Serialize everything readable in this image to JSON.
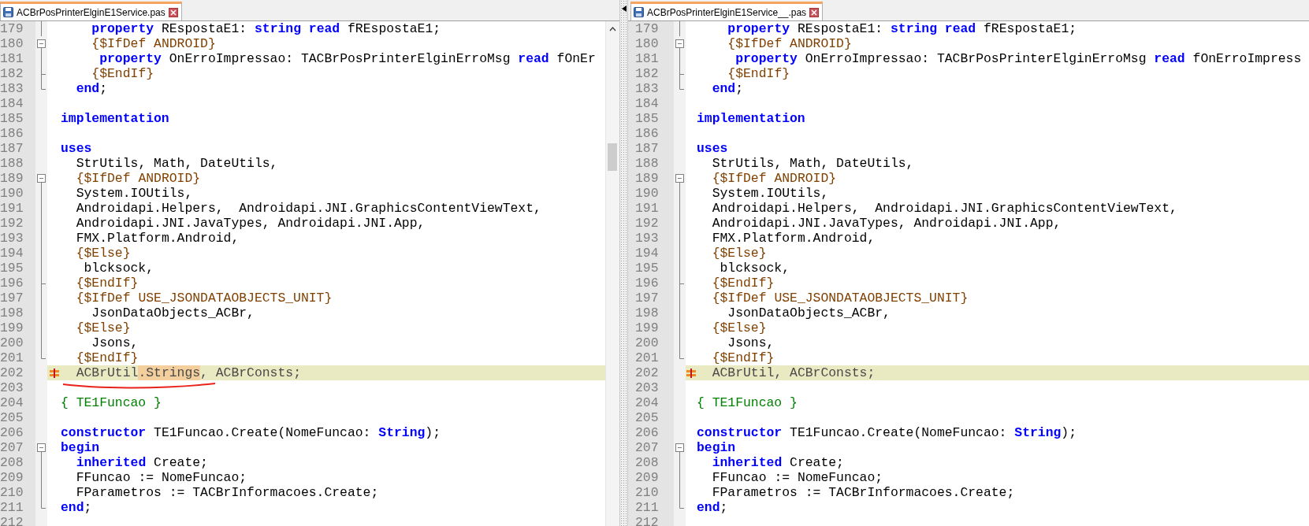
{
  "panes": [
    {
      "tab": {
        "title": "ACBrPosPrinterElginE1Service.pas",
        "selected": true
      },
      "lines": [
        {
          "number": "179",
          "kind": "fold-mid",
          "changed": false,
          "segments": [
            {
              "kind": "keyword",
              "text": "    property"
            },
            {
              "kind": "plain",
              "text": " REspostaE1: "
            },
            {
              "kind": "keyword",
              "text": "string"
            },
            {
              "kind": "keyword",
              "text": " read"
            },
            {
              "kind": "plain",
              "text": " fREspostaE1;"
            }
          ]
        },
        {
          "number": "180",
          "kind": "fold-start",
          "changed": false,
          "segments": [
            {
              "kind": "directive",
              "text": "    {$IfDef ANDROID}"
            }
          ]
        },
        {
          "number": "181",
          "kind": "fold-mid",
          "changed": false,
          "segments": [
            {
              "kind": "keyword",
              "text": "     property"
            },
            {
              "kind": "plain",
              "text": " OnErroImpressao: TACBrPosPrinterElginErroMsg "
            },
            {
              "kind": "keyword",
              "text": "read"
            },
            {
              "kind": "plain",
              "text": " fOnEr"
            }
          ]
        },
        {
          "number": "182",
          "kind": "fold-branch",
          "changed": false,
          "segments": [
            {
              "kind": "directive",
              "text": "    {$EndIf}"
            }
          ]
        },
        {
          "number": "183",
          "kind": "fold-end",
          "changed": false,
          "segments": [
            {
              "kind": "keyword",
              "text": "  end"
            },
            {
              "kind": "plain",
              "text": ";"
            }
          ]
        },
        {
          "number": "184",
          "kind": "plain",
          "changed": false
        },
        {
          "number": "185",
          "kind": "plain",
          "changed": false,
          "segments": [
            {
              "kind": "keyword",
              "text": "implementation"
            }
          ]
        },
        {
          "number": "186",
          "kind": "plain",
          "changed": false
        },
        {
          "number": "187",
          "kind": "plain",
          "changed": false,
          "segments": [
            {
              "kind": "keyword",
              "text": "uses"
            }
          ]
        },
        {
          "number": "188",
          "kind": "plain",
          "changed": false,
          "segments": [
            {
              "kind": "plain",
              "text": "  StrUtils, Math, DateUtils,"
            }
          ]
        },
        {
          "number": "189",
          "kind": "fold-start",
          "changed": false,
          "segments": [
            {
              "kind": "directive",
              "text": "  {$IfDef ANDROID}"
            }
          ]
        },
        {
          "number": "190",
          "kind": "fold-mid",
          "changed": false,
          "segments": [
            {
              "kind": "plain",
              "text": "  System.IOUtils,"
            }
          ]
        },
        {
          "number": "191",
          "kind": "fold-mid",
          "changed": false,
          "segments": [
            {
              "kind": "plain",
              "text": "  Androidapi.Helpers,  Androidapi.JNI.GraphicsContentViewText,"
            }
          ]
        },
        {
          "number": "192",
          "kind": "fold-mid",
          "changed": false,
          "segments": [
            {
              "kind": "plain",
              "text": "  Androidapi.JNI.JavaTypes, Androidapi.JNI.App,"
            }
          ]
        },
        {
          "number": "193",
          "kind": "fold-mid",
          "changed": false,
          "segments": [
            {
              "kind": "plain",
              "text": "  FMX.Platform.Android,"
            }
          ]
        },
        {
          "number": "194",
          "kind": "fold-mid",
          "changed": false,
          "segments": [
            {
              "kind": "directive",
              "text": "  {$Else}"
            }
          ]
        },
        {
          "number": "195",
          "kind": "fold-mid",
          "changed": false,
          "segments": [
            {
              "kind": "plain",
              "text": "   blcksock,"
            }
          ]
        },
        {
          "number": "196",
          "kind": "fold-branch",
          "changed": false,
          "segments": [
            {
              "kind": "directive",
              "text": "  {$EndIf}"
            }
          ]
        },
        {
          "number": "197",
          "kind": "fold-mid",
          "changed": false,
          "segments": [
            {
              "kind": "directive",
              "text": "  {$IfDef USE_JSONDATAOBJECTS_UNIT}"
            }
          ]
        },
        {
          "number": "198",
          "kind": "fold-mid",
          "changed": false,
          "segments": [
            {
              "kind": "plain",
              "text": "    JsonDataObjects_ACBr,"
            }
          ]
        },
        {
          "number": "199",
          "kind": "fold-mid",
          "changed": false,
          "segments": [
            {
              "kind": "directive",
              "text": "  {$Else}"
            }
          ]
        },
        {
          "number": "200",
          "kind": "fold-mid",
          "changed": false,
          "segments": [
            {
              "kind": "plain",
              "text": "    Jsons,"
            }
          ]
        },
        {
          "number": "201",
          "kind": "fold-end",
          "changed": false,
          "segments": [
            {
              "kind": "directive",
              "text": "  {$EndIf}"
            }
          ]
        },
        {
          "number": "202",
          "kind": "plain",
          "changed": true,
          "segments": [
            {
              "kind": "plain",
              "text": "  ACBrUtil"
            },
            {
              "kind": "diff",
              "text": ".Strings"
            },
            {
              "kind": "plain",
              "text": ", ACBrConsts;"
            }
          ]
        },
        {
          "number": "203",
          "kind": "plain",
          "changed": false
        },
        {
          "number": "204",
          "kind": "plain",
          "changed": false,
          "segments": [
            {
              "kind": "comment",
              "text": "{ TE1Funcao }"
            }
          ]
        },
        {
          "number": "205",
          "kind": "plain",
          "changed": false
        },
        {
          "number": "206",
          "kind": "plain",
          "changed": false,
          "segments": [
            {
              "kind": "keyword",
              "text": "constructor"
            },
            {
              "kind": "plain",
              "text": " TE1Funcao.Create(NomeFuncao: "
            },
            {
              "kind": "keyword",
              "text": "String"
            },
            {
              "kind": "plain",
              "text": ");"
            }
          ]
        },
        {
          "number": "207",
          "kind": "fold-start",
          "changed": false,
          "segments": [
            {
              "kind": "keyword",
              "text": "begin"
            }
          ]
        },
        {
          "number": "208",
          "kind": "fold-mid",
          "changed": false,
          "segments": [
            {
              "kind": "keyword",
              "text": "  inherited"
            },
            {
              "kind": "plain",
              "text": " Create;"
            }
          ]
        },
        {
          "number": "209",
          "kind": "fold-mid",
          "changed": false,
          "segments": [
            {
              "kind": "plain",
              "text": "  FFuncao := NomeFuncao;"
            }
          ]
        },
        {
          "number": "210",
          "kind": "fold-mid",
          "changed": false,
          "segments": [
            {
              "kind": "plain",
              "text": "  FParametros := TACBrInformacoes.Create;"
            }
          ]
        },
        {
          "number": "211",
          "kind": "fold-end",
          "changed": false,
          "segments": [
            {
              "kind": "keyword",
              "text": "end"
            },
            {
              "kind": "plain",
              "text": ";"
            }
          ]
        },
        {
          "number": "212",
          "kind": "plain",
          "changed": false
        }
      ]
    },
    {
      "tab": {
        "title": "ACBrPosPrinterElginE1Service__.pas",
        "selected": true
      },
      "lines": [
        {
          "number": "179",
          "kind": "fold-mid",
          "changed": false,
          "segments": [
            {
              "kind": "keyword",
              "text": "    property"
            },
            {
              "kind": "plain",
              "text": " REspostaE1: "
            },
            {
              "kind": "keyword",
              "text": "string"
            },
            {
              "kind": "keyword",
              "text": " read"
            },
            {
              "kind": "plain",
              "text": " fREspostaE1;"
            }
          ]
        },
        {
          "number": "180",
          "kind": "fold-start",
          "changed": false,
          "segments": [
            {
              "kind": "directive",
              "text": "    {$IfDef ANDROID}"
            }
          ]
        },
        {
          "number": "181",
          "kind": "fold-mid",
          "changed": false,
          "segments": [
            {
              "kind": "keyword",
              "text": "     property"
            },
            {
              "kind": "plain",
              "text": " OnErroImpressao: TACBrPosPrinterElginErroMsg "
            },
            {
              "kind": "keyword",
              "text": "read"
            },
            {
              "kind": "plain",
              "text": " fOnErroImpress"
            }
          ]
        },
        {
          "number": "182",
          "kind": "fold-branch",
          "changed": false,
          "segments": [
            {
              "kind": "directive",
              "text": "    {$EndIf}"
            }
          ]
        },
        {
          "number": "183",
          "kind": "fold-end",
          "changed": false,
          "segments": [
            {
              "kind": "keyword",
              "text": "  end"
            },
            {
              "kind": "plain",
              "text": ";"
            }
          ]
        },
        {
          "number": "184",
          "kind": "plain",
          "changed": false
        },
        {
          "number": "185",
          "kind": "plain",
          "changed": false,
          "segments": [
            {
              "kind": "keyword",
              "text": "implementation"
            }
          ]
        },
        {
          "number": "186",
          "kind": "plain",
          "changed": false
        },
        {
          "number": "187",
          "kind": "plain",
          "changed": false,
          "segments": [
            {
              "kind": "keyword",
              "text": "uses"
            }
          ]
        },
        {
          "number": "188",
          "kind": "plain",
          "changed": false,
          "segments": [
            {
              "kind": "plain",
              "text": "  StrUtils, Math, DateUtils,"
            }
          ]
        },
        {
          "number": "189",
          "kind": "fold-start",
          "changed": false,
          "segments": [
            {
              "kind": "directive",
              "text": "  {$IfDef ANDROID}"
            }
          ]
        },
        {
          "number": "190",
          "kind": "fold-mid",
          "changed": false,
          "segments": [
            {
              "kind": "plain",
              "text": "  System.IOUtils,"
            }
          ]
        },
        {
          "number": "191",
          "kind": "fold-mid",
          "changed": false,
          "segments": [
            {
              "kind": "plain",
              "text": "  Androidapi.Helpers,  Androidapi.JNI.GraphicsContentViewText,"
            }
          ]
        },
        {
          "number": "192",
          "kind": "fold-mid",
          "changed": false,
          "segments": [
            {
              "kind": "plain",
              "text": "  Androidapi.JNI.JavaTypes, Androidapi.JNI.App,"
            }
          ]
        },
        {
          "number": "193",
          "kind": "fold-mid",
          "changed": false,
          "segments": [
            {
              "kind": "plain",
              "text": "  FMX.Platform.Android,"
            }
          ]
        },
        {
          "number": "194",
          "kind": "fold-mid",
          "changed": false,
          "segments": [
            {
              "kind": "directive",
              "text": "  {$Else}"
            }
          ]
        },
        {
          "number": "195",
          "kind": "fold-mid",
          "changed": false,
          "segments": [
            {
              "kind": "plain",
              "text": "   blcksock,"
            }
          ]
        },
        {
          "number": "196",
          "kind": "fold-branch",
          "changed": false,
          "segments": [
            {
              "kind": "directive",
              "text": "  {$EndIf}"
            }
          ]
        },
        {
          "number": "197",
          "kind": "fold-mid",
          "changed": false,
          "segments": [
            {
              "kind": "directive",
              "text": "  {$IfDef USE_JSONDATAOBJECTS_UNIT}"
            }
          ]
        },
        {
          "number": "198",
          "kind": "fold-mid",
          "changed": false,
          "segments": [
            {
              "kind": "plain",
              "text": "    JsonDataObjects_ACBr,"
            }
          ]
        },
        {
          "number": "199",
          "kind": "fold-mid",
          "changed": false,
          "segments": [
            {
              "kind": "directive",
              "text": "  {$Else}"
            }
          ]
        },
        {
          "number": "200",
          "kind": "fold-mid",
          "changed": false,
          "segments": [
            {
              "kind": "plain",
              "text": "    Jsons,"
            }
          ]
        },
        {
          "number": "201",
          "kind": "fold-end",
          "changed": false,
          "segments": [
            {
              "kind": "directive",
              "text": "  {$EndIf}"
            }
          ]
        },
        {
          "number": "202",
          "kind": "plain",
          "changed": true,
          "segments": [
            {
              "kind": "plain",
              "text": "  ACBrUtil, ACBrConsts;"
            }
          ]
        },
        {
          "number": "203",
          "kind": "plain",
          "changed": false
        },
        {
          "number": "204",
          "kind": "plain",
          "changed": false,
          "segments": [
            {
              "kind": "comment",
              "text": "{ TE1Funcao }"
            }
          ]
        },
        {
          "number": "205",
          "kind": "plain",
          "changed": false
        },
        {
          "number": "206",
          "kind": "plain",
          "changed": false,
          "segments": [
            {
              "kind": "keyword",
              "text": "constructor"
            },
            {
              "kind": "plain",
              "text": " TE1Funcao.Create(NomeFuncao: "
            },
            {
              "kind": "keyword",
              "text": "String"
            },
            {
              "kind": "plain",
              "text": ");"
            }
          ]
        },
        {
          "number": "207",
          "kind": "fold-start",
          "changed": false,
          "segments": [
            {
              "kind": "keyword",
              "text": "begin"
            }
          ]
        },
        {
          "number": "208",
          "kind": "fold-mid",
          "changed": false,
          "segments": [
            {
              "kind": "keyword",
              "text": "  inherited"
            },
            {
              "kind": "plain",
              "text": " Create;"
            }
          ]
        },
        {
          "number": "209",
          "kind": "fold-mid",
          "changed": false,
          "segments": [
            {
              "kind": "plain",
              "text": "  FFuncao := NomeFuncao;"
            }
          ]
        },
        {
          "number": "210",
          "kind": "fold-mid",
          "changed": false,
          "segments": [
            {
              "kind": "plain",
              "text": "  FParametros := TACBrInformacoes.Create;"
            }
          ]
        },
        {
          "number": "211",
          "kind": "fold-end",
          "changed": false,
          "segments": [
            {
              "kind": "keyword",
              "text": "end"
            },
            {
              "kind": "plain",
              "text": ";"
            }
          ]
        },
        {
          "number": "212",
          "kind": "plain",
          "changed": false
        }
      ]
    }
  ]
}
